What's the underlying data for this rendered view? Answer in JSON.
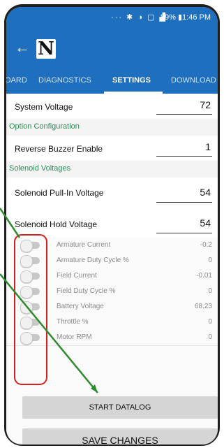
{
  "status_bar": {
    "icons": "··· ✱ ◑ ▢ ▟",
    "text": "89% ▮1:46 PM"
  },
  "app_bar": {
    "back_icon": "arrow-left-icon",
    "logo_letter": "N"
  },
  "tabs": [
    {
      "label": "OARD",
      "active": false
    },
    {
      "label": "DIAGNOSTICS",
      "active": false
    },
    {
      "label": "SETTINGS",
      "active": true
    },
    {
      "label": "DOWNLOAD",
      "active": false
    }
  ],
  "settings": {
    "system_voltage": {
      "label": "System Voltage",
      "value": "72"
    },
    "option_configuration": "Option Configuration",
    "reverse_buzzer": {
      "label": "Reverse Buzzer Enable",
      "value": "1"
    },
    "solenoid_voltages": "Solenoid Voltages",
    "pull_in": {
      "label": "Solenoid Pull-In Voltage",
      "value": "54"
    },
    "hold": {
      "label": "Solenoid Hold Voltage",
      "value": "54"
    }
  },
  "datalog_items": [
    {
      "label": "Armature Current",
      "value": "-0.2"
    },
    {
      "label": "Armature Duty Cycle %",
      "value": "0"
    },
    {
      "label": "Field Current",
      "value": "-0.01"
    },
    {
      "label": "Field Duty Cycle %",
      "value": "0"
    },
    {
      "label": "Battery Voltage",
      "value": "68.23"
    },
    {
      "label": "Throttle %",
      "value": "0"
    },
    {
      "label": "Motor RPM",
      "value": "0"
    }
  ],
  "buttons": {
    "start_datalog": "START DATALOG",
    "save_changes": "SAVE CHANGES"
  },
  "annotation_colors": {
    "highlight": "#d62020",
    "arrow": "#2e8b2e"
  }
}
